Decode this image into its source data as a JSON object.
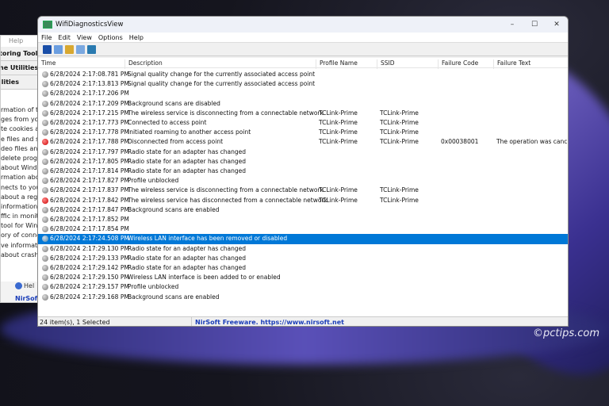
{
  "background_window": {
    "menu": "Help",
    "tools": [
      "toring Tools",
      "ne Utilities",
      "ilities"
    ],
    "lines": [
      "rmation of the",
      "ges from your",
      "te cookies and",
      "e files and sav",
      "deo files and F",
      "delete program",
      "about Windo",
      "rmation about",
      "nects to your r",
      "about a regist",
      "information a",
      "ffic in monito",
      "tool for Wind",
      "ory of connec",
      "ve information",
      "about crashe"
    ],
    "help_label": "Hel",
    "footer_link": "NirSoft"
  },
  "window": {
    "title": "WifiDiagnosticsView",
    "minimize": "–",
    "maximize": "☐",
    "close": "✕"
  },
  "menu": [
    "File",
    "Edit",
    "View",
    "Options",
    "Help"
  ],
  "toolbar": [
    {
      "icon": "save-icon",
      "color": "#1a4fa8"
    },
    {
      "icon": "copy-icon",
      "color": "#6b9ee0"
    },
    {
      "icon": "properties-icon",
      "color": "#d8a830"
    },
    {
      "icon": "html-report-icon",
      "color": "#7aa8e0"
    },
    {
      "icon": "exit-icon",
      "color": "#2a7ab0"
    }
  ],
  "columns": [
    "Time",
    "Description",
    "Profile Name",
    "SSID",
    "Failure Code",
    "Failure Text"
  ],
  "rows": [
    {
      "status": "gray",
      "time": "6/28/2024 2:17:08.781 PM",
      "desc": "Signal quality change for the currently associated access point",
      "profile": "",
      "ssid": "",
      "code": "",
      "text": ""
    },
    {
      "status": "gray",
      "time": "6/28/2024 2:17:13.813 PM",
      "desc": "Signal quality change for the currently associated access point",
      "profile": "",
      "ssid": "",
      "code": "",
      "text": ""
    },
    {
      "status": "gray",
      "time": "6/28/2024 2:17:17.206 PM",
      "desc": "",
      "profile": "",
      "ssid": "",
      "code": "",
      "text": ""
    },
    {
      "status": "gray",
      "time": "6/28/2024 2:17:17.209 PM",
      "desc": "Background scans are disabled",
      "profile": "",
      "ssid": "",
      "code": "",
      "text": ""
    },
    {
      "status": "gray",
      "time": "6/28/2024 2:17:17.215 PM",
      "desc": "The wireless service is disconnecting from a connectable network",
      "profile": "TCLink-Prime",
      "ssid": "TCLink-Prime",
      "code": "",
      "text": ""
    },
    {
      "status": "gray",
      "time": "6/28/2024 2:17:17.773 PM",
      "desc": "Connected to access point",
      "profile": "TCLink-Prime",
      "ssid": "TCLink-Prime",
      "code": "",
      "text": ""
    },
    {
      "status": "gray",
      "time": "6/28/2024 2:17:17.778 PM",
      "desc": "Initiated roaming to another access point",
      "profile": "TCLink-Prime",
      "ssid": "TCLink-Prime",
      "code": "",
      "text": ""
    },
    {
      "status": "red",
      "time": "6/28/2024 2:17:17.788 PM",
      "desc": "Disconnected from access point",
      "profile": "TCLink-Prime",
      "ssid": "TCLink-Prime",
      "code": "0x00038001",
      "text": "The operation was canc..."
    },
    {
      "status": "gray",
      "time": "6/28/2024 2:17:17.797 PM",
      "desc": "Radio state for an adapter has changed",
      "profile": "",
      "ssid": "",
      "code": "",
      "text": ""
    },
    {
      "status": "gray",
      "time": "6/28/2024 2:17:17.805 PM",
      "desc": "Radio state for an adapter has changed",
      "profile": "",
      "ssid": "",
      "code": "",
      "text": ""
    },
    {
      "status": "gray",
      "time": "6/28/2024 2:17:17.814 PM",
      "desc": "Radio state for an adapter has changed",
      "profile": "",
      "ssid": "",
      "code": "",
      "text": ""
    },
    {
      "status": "gray",
      "time": "6/28/2024 2:17:17.827 PM",
      "desc": "Profile unblocked",
      "profile": "",
      "ssid": "",
      "code": "",
      "text": ""
    },
    {
      "status": "gray",
      "time": "6/28/2024 2:17:17.837 PM",
      "desc": "The wireless service is disconnecting from a connectable network",
      "profile": "TCLink-Prime",
      "ssid": "TCLink-Prime",
      "code": "",
      "text": ""
    },
    {
      "status": "red",
      "time": "6/28/2024 2:17:17.842 PM",
      "desc": "The wireless service has disconnected from a connectable network",
      "profile": "TCLink-Prime",
      "ssid": "TCLink-Prime",
      "code": "",
      "text": ""
    },
    {
      "status": "gray",
      "time": "6/28/2024 2:17:17.847 PM",
      "desc": "Background scans are enabled",
      "profile": "",
      "ssid": "",
      "code": "",
      "text": ""
    },
    {
      "status": "gray",
      "time": "6/28/2024 2:17:17.852 PM",
      "desc": "",
      "profile": "",
      "ssid": "",
      "code": "",
      "text": ""
    },
    {
      "status": "gray",
      "time": "6/28/2024 2:17:17.854 PM",
      "desc": "",
      "profile": "",
      "ssid": "",
      "code": "",
      "text": ""
    },
    {
      "status": "blue",
      "selected": true,
      "time": "6/28/2024 2:17:24.508 PM",
      "desc": "Wireless LAN interface has been removed or disabled",
      "profile": "",
      "ssid": "",
      "code": "",
      "text": ""
    },
    {
      "status": "gray",
      "time": "6/28/2024 2:17:29.130 PM",
      "desc": "Radio state for an adapter has changed",
      "profile": "",
      "ssid": "",
      "code": "",
      "text": ""
    },
    {
      "status": "gray",
      "time": "6/28/2024 2:17:29.133 PM",
      "desc": "Radio state for an adapter has changed",
      "profile": "",
      "ssid": "",
      "code": "",
      "text": ""
    },
    {
      "status": "gray",
      "time": "6/28/2024 2:17:29.142 PM",
      "desc": "Radio state for an adapter has changed",
      "profile": "",
      "ssid": "",
      "code": "",
      "text": ""
    },
    {
      "status": "gray",
      "time": "6/28/2024 2:17:29.150 PM",
      "desc": "Wireless LAN interface is been added to or enabled",
      "profile": "",
      "ssid": "",
      "code": "",
      "text": ""
    },
    {
      "status": "gray",
      "time": "6/28/2024 2:17:29.157 PM",
      "desc": "Profile unblocked",
      "profile": "",
      "ssid": "",
      "code": "",
      "text": ""
    },
    {
      "status": "gray",
      "time": "6/28/2024 2:17:29.168 PM",
      "desc": "Background scans are enabled",
      "profile": "",
      "ssid": "",
      "code": "",
      "text": ""
    }
  ],
  "status": {
    "count": "24 item(s), 1 Selected",
    "link": "NirSoft Freeware. https://www.nirsoft.net"
  },
  "watermark": "©pctips.com",
  "colors": {
    "selection": "#0078d7",
    "link": "#1a3db8"
  }
}
